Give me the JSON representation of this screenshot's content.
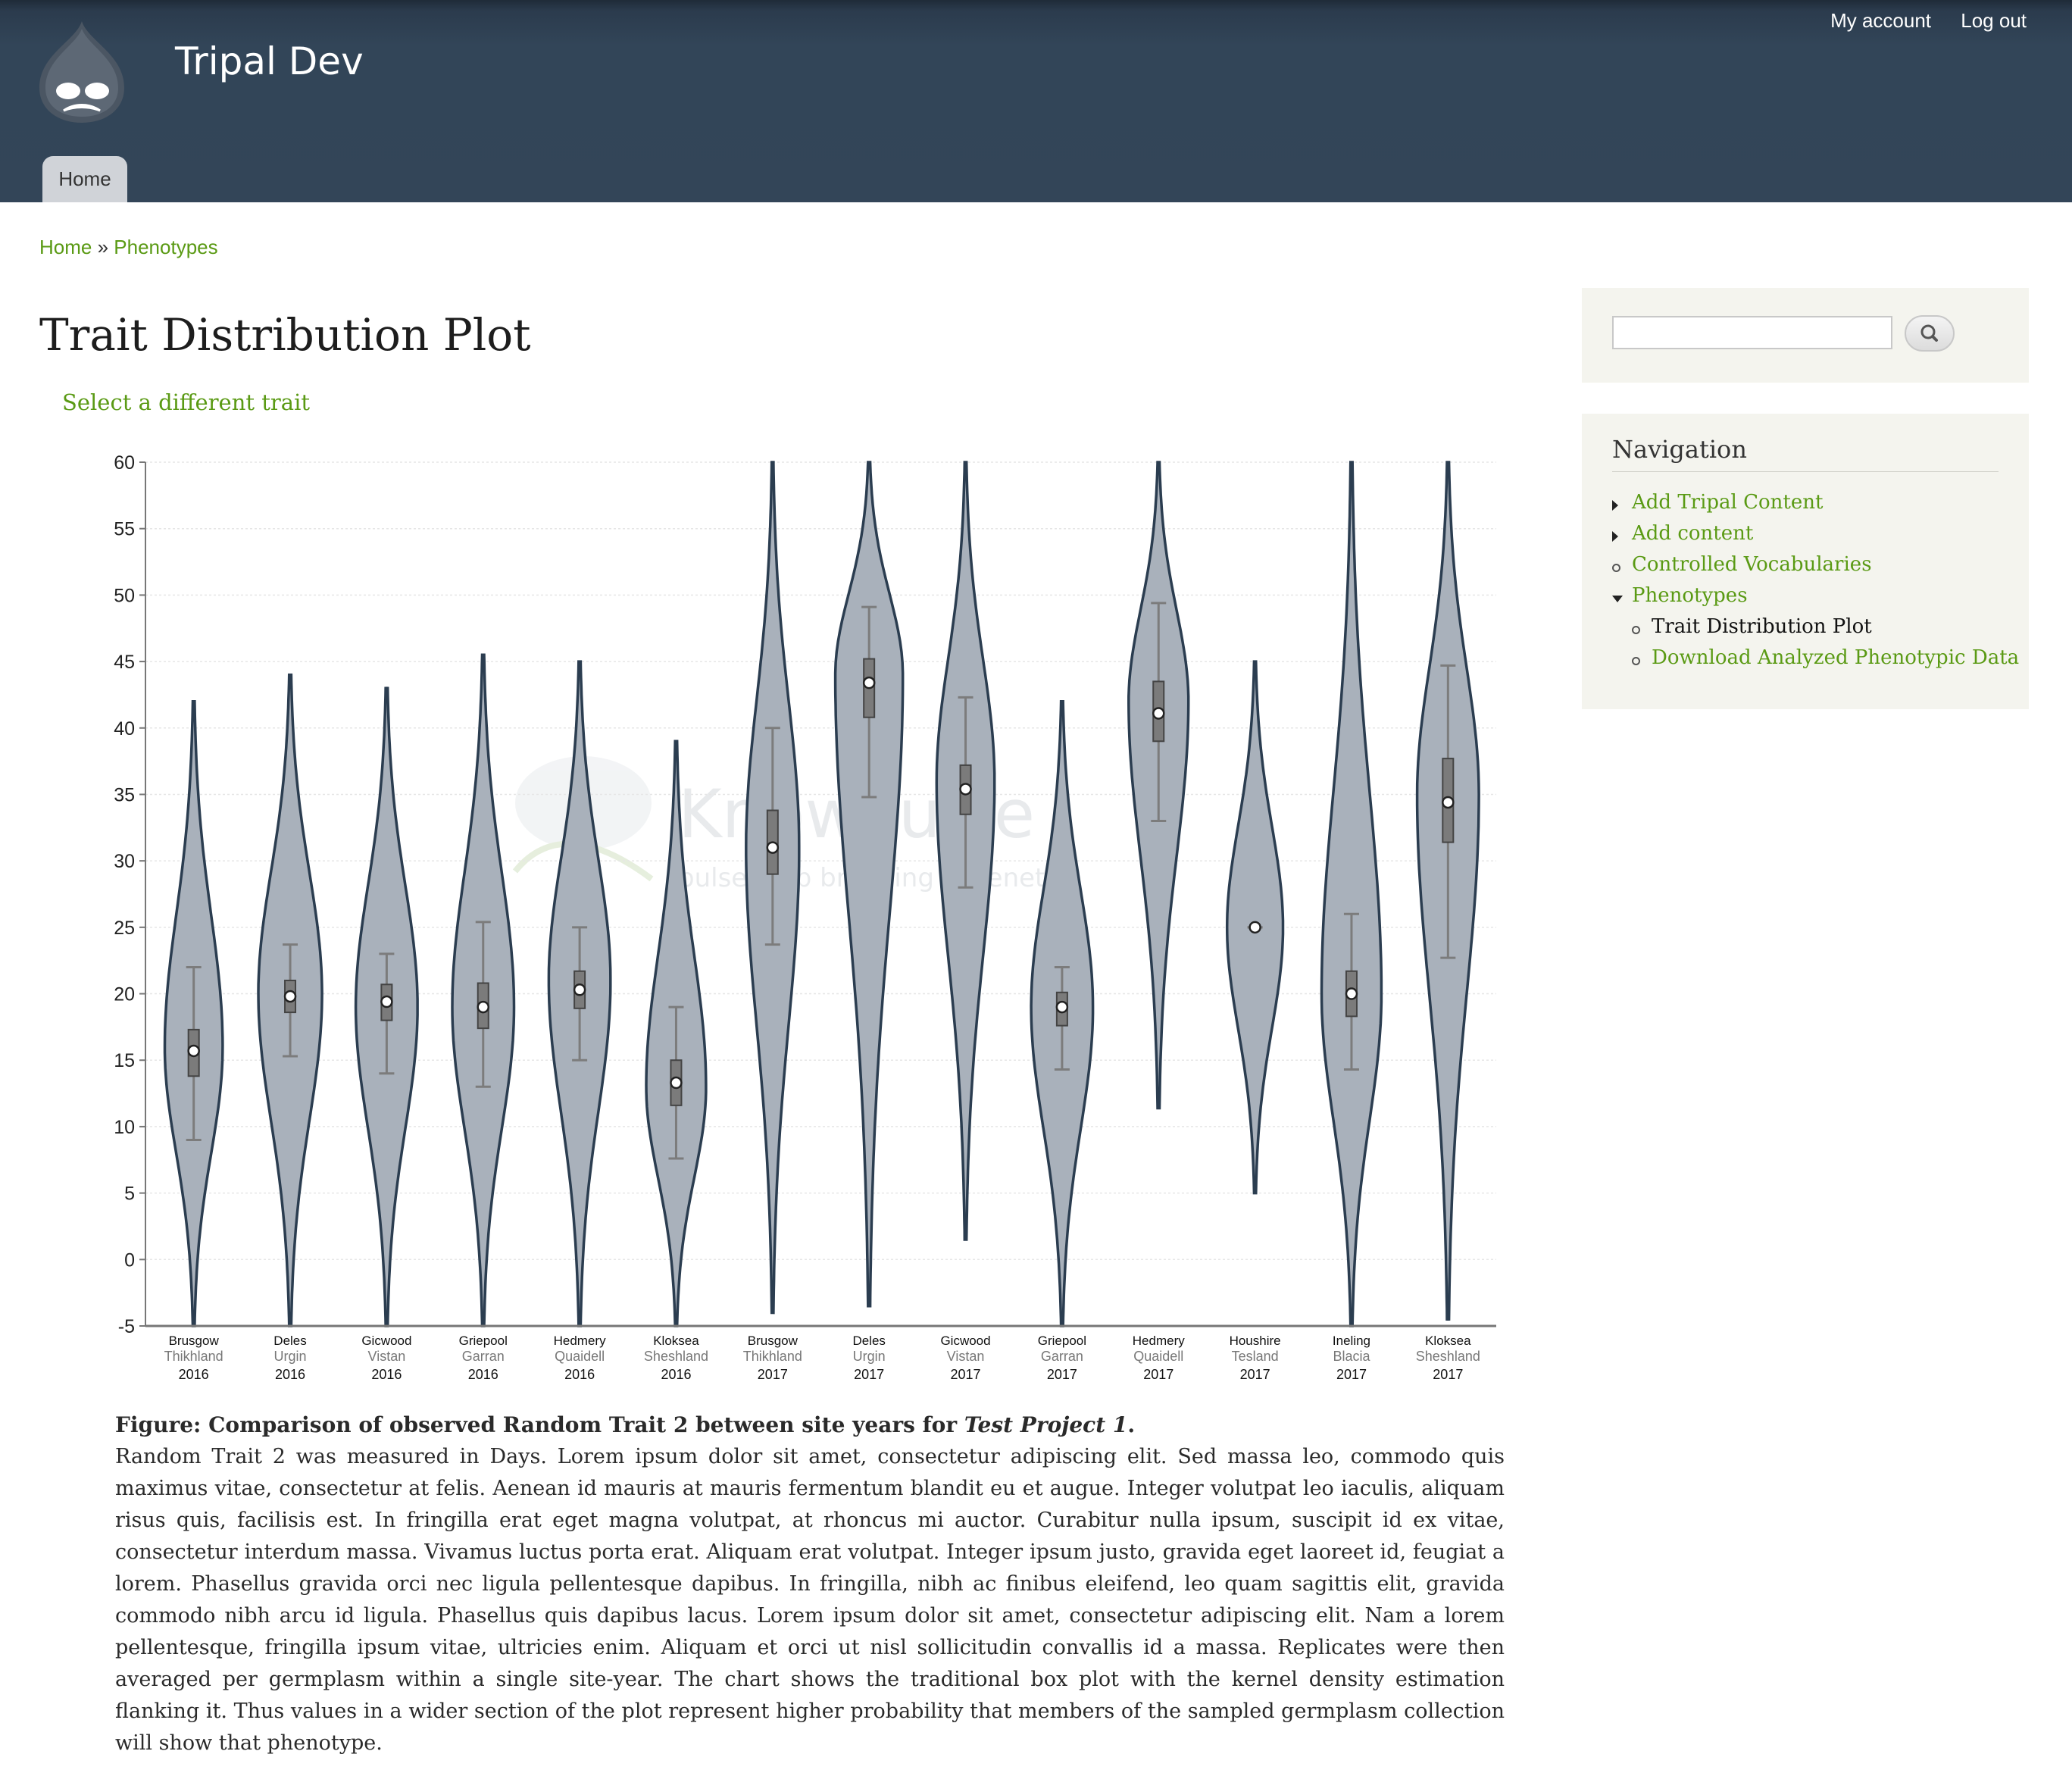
{
  "header": {
    "site_name": "Tripal Dev",
    "user_menu": [
      "My account",
      "Log out"
    ],
    "tabs": [
      {
        "label": "Home"
      }
    ]
  },
  "breadcrumb": {
    "items": [
      "Home",
      "Phenotypes"
    ],
    "separator": "»"
  },
  "page": {
    "title": "Trait Distribution Plot",
    "select_trait_link": "Select a different trait"
  },
  "figure": {
    "caption_prefix": "Figure: Comparison of observed Random Trait 2 between site years for",
    "caption_project": "Test Project 1",
    "caption_suffix": ".",
    "body": "Random Trait 2 was measured in Days. Lorem ipsum dolor sit amet, consectetur adipiscing elit. Sed massa leo, commodo quis maximus vitae, consectetur at felis. Aenean id mauris at mauris fermentum blandit eu et augue. Integer volutpat leo iaculis, aliquam risus quis, facilisis est. In fringilla erat eget magna volutpat, at rhoncus mi auctor. Curabitur nulla ipsum, suscipit id ex vitae, consectetur interdum massa. Vivamus luctus porta erat. Aliquam erat volutpat. Integer ipsum justo, gravida eget laoreet id, feugiat a lorem. Phasellus gravida orci nec ligula pellentesque dapibus. In fringilla, nibh ac finibus eleifend, leo quam sagittis elit, gravida commodo nibh arcu id ligula. Phasellus quis dapibus lacus. Lorem ipsum dolor sit amet, consectetur adipiscing elit. Nam a lorem pellentesque, fringilla ipsum vitae, ultricies enim. Aliquam et orci ut nisl sollicitudin convallis id a massa. Replicates were then averaged per germplasm within a single site-year. The chart shows the traditional box plot with the kernel density estimation flanking it. Thus values in a wider section of the plot represent higher probability that members of the sampled germplasm collection will show that phenotype."
  },
  "sidebar": {
    "search": {
      "placeholder": "",
      "value": "",
      "button_icon": "search-icon"
    },
    "navigation": {
      "title": "Navigation",
      "items": [
        {
          "label": "Add Tripal Content",
          "bullet": "collapsed",
          "active": false,
          "level": 0
        },
        {
          "label": "Add content",
          "bullet": "collapsed",
          "active": false,
          "level": 0
        },
        {
          "label": "Controlled Vocabularies",
          "bullet": "leaf",
          "active": false,
          "level": 0
        },
        {
          "label": "Phenotypes",
          "bullet": "expanded",
          "active": false,
          "level": 0
        },
        {
          "label": "Trait Distribution Plot",
          "bullet": "leaf",
          "active": true,
          "level": 1
        },
        {
          "label": "Download Analyzed Phenotypic Data",
          "bullet": "leaf",
          "active": false,
          "level": 1
        }
      ]
    }
  },
  "colors": {
    "header_bg": "#334558",
    "link": "#5a9a14",
    "violin_fill": "#a9b1bb",
    "violin_stroke": "#2b3d50",
    "box_fill": "#7b7b7b"
  },
  "chart_data": {
    "type": "violin",
    "ylim": [
      -5,
      60
    ],
    "yticks": [
      -5,
      0,
      5,
      10,
      15,
      20,
      25,
      30,
      35,
      40,
      45,
      50,
      55,
      60
    ],
    "grid": true,
    "watermark": {
      "name": "KnowPulse",
      "tagline": "pulse crop breeding & genetics"
    },
    "groups": [
      {
        "germplasm": "Brusgow",
        "site": "Thikhland",
        "year": "2016",
        "median": 15.7,
        "q1": 13.8,
        "q3": 17.3,
        "whisker_low": 9,
        "whisker_high": 22,
        "min": -5,
        "max": 42,
        "mode": 16,
        "spread": 0.6
      },
      {
        "germplasm": "Deles",
        "site": "Urgin",
        "year": "2016",
        "median": 19.8,
        "q1": 18.6,
        "q3": 21,
        "whisker_low": 15.3,
        "whisker_high": 23.7,
        "min": -5,
        "max": 44,
        "mode": 20,
        "spread": 0.66
      },
      {
        "germplasm": "Gicwood",
        "site": "Vistan",
        "year": "2016",
        "median": 19.4,
        "q1": 18,
        "q3": 20.7,
        "whisker_low": 14,
        "whisker_high": 23,
        "min": -5,
        "max": 43,
        "mode": 19,
        "spread": 0.64
      },
      {
        "germplasm": "Griepool",
        "site": "Garran",
        "year": "2016",
        "median": 19,
        "q1": 17.4,
        "q3": 20.8,
        "whisker_low": 13,
        "whisker_high": 25.4,
        "min": -5,
        "max": 45.5,
        "mode": 19,
        "spread": 0.64
      },
      {
        "germplasm": "Hedmery",
        "site": "Quaidell",
        "year": "2016",
        "median": 20.3,
        "q1": 18.9,
        "q3": 21.7,
        "whisker_low": 15,
        "whisker_high": 25,
        "min": -5,
        "max": 45,
        "mode": 21,
        "spread": 0.64
      },
      {
        "germplasm": "Kloksea",
        "site": "Sheshland",
        "year": "2016",
        "median": 13.3,
        "q1": 11.6,
        "q3": 15,
        "whisker_low": 7.6,
        "whisker_high": 19,
        "min": -5,
        "max": 39,
        "mode": 13,
        "spread": 0.62
      },
      {
        "germplasm": "Brusgow",
        "site": "Thikhland",
        "year": "2017",
        "median": 31,
        "q1": 29,
        "q3": 33.8,
        "whisker_low": 23.7,
        "whisker_high": 40,
        "min": -4,
        "max": 60,
        "mode": 31,
        "spread": 0.55
      },
      {
        "germplasm": "Deles",
        "site": "Urgin",
        "year": "2017",
        "median": 43.4,
        "q1": 40.8,
        "q3": 45.2,
        "whisker_low": 34.8,
        "whisker_high": 49.1,
        "min": -3.5,
        "max": 60,
        "mode": 44,
        "spread": 0.7
      },
      {
        "germplasm": "Gicwood",
        "site": "Vistan",
        "year": "2017",
        "median": 35.4,
        "q1": 33.5,
        "q3": 37.2,
        "whisker_low": 28,
        "whisker_high": 42.3,
        "min": 1.5,
        "max": 60,
        "mode": 36,
        "spread": 0.6
      },
      {
        "germplasm": "Griepool",
        "site": "Garran",
        "year": "2017",
        "median": 19,
        "q1": 17.6,
        "q3": 20.1,
        "whisker_low": 14.3,
        "whisker_high": 22,
        "min": -5,
        "max": 42,
        "mode": 19,
        "spread": 0.64
      },
      {
        "germplasm": "Hedmery",
        "site": "Quaidell",
        "year": "2017",
        "median": 41.1,
        "q1": 39,
        "q3": 43.5,
        "whisker_low": 33,
        "whisker_high": 49.4,
        "min": 11.4,
        "max": 60,
        "mode": 42,
        "spread": 0.62
      },
      {
        "germplasm": "Houshire",
        "site": "Tesland",
        "year": "2017",
        "median": 25,
        "q1": 25,
        "q3": 25,
        "whisker_low": 25,
        "whisker_high": 25,
        "min": 5,
        "max": 45,
        "mode": 25,
        "spread": 0.58
      },
      {
        "germplasm": "Ineling",
        "site": "Blacia",
        "year": "2017",
        "median": 20,
        "q1": 18.3,
        "q3": 21.7,
        "whisker_low": 14.3,
        "whisker_high": 26,
        "min": -5,
        "max": 60,
        "mode": 20,
        "spread": 0.62
      },
      {
        "germplasm": "Kloksea",
        "site": "Sheshland",
        "year": "2017",
        "median": 34.4,
        "q1": 31.4,
        "q3": 37.7,
        "whisker_low": 22.7,
        "whisker_high": 44.7,
        "min": -4.5,
        "max": 60,
        "mode": 35,
        "spread": 0.64
      }
    ]
  }
}
